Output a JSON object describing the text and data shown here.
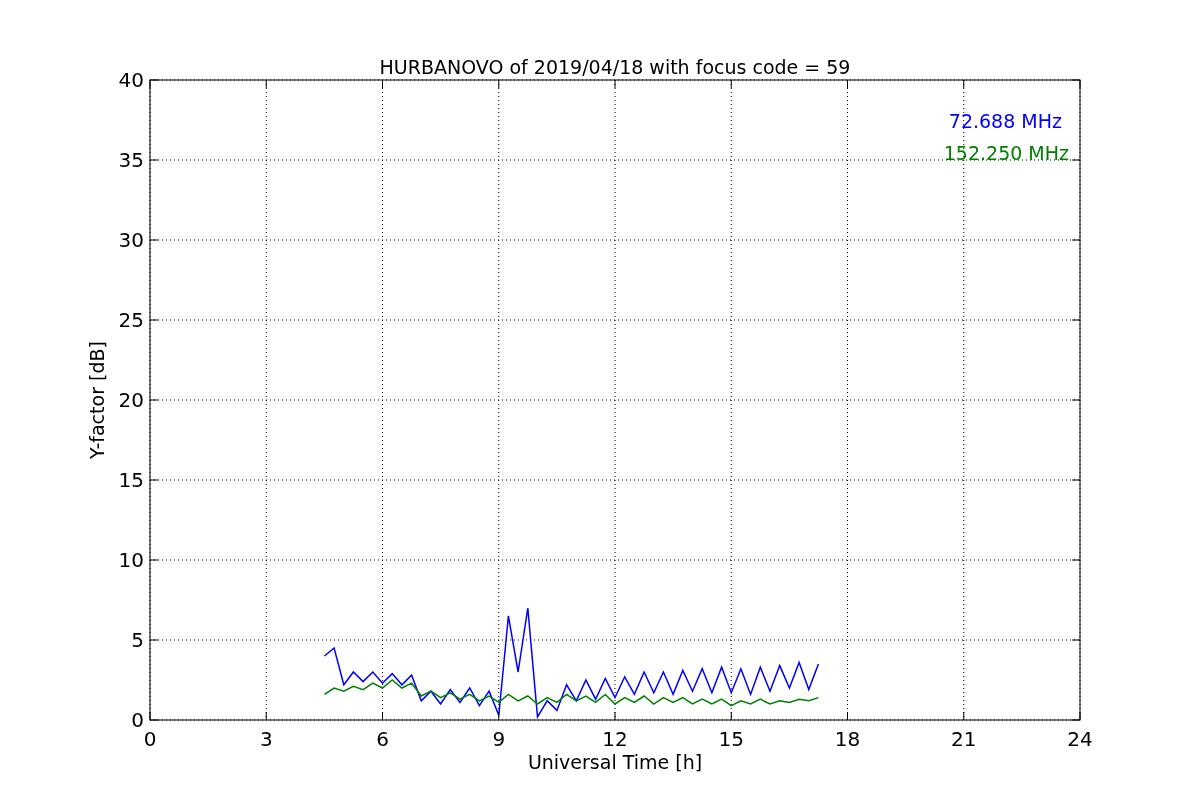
{
  "figure": {
    "chart_data": {
      "type": "line",
      "grid": true,
      "title": "HURBANOVO of 2019/04/18 with focus code = 59",
      "xlabel": "Universal Time [h]",
      "ylabel": "Y-factor [dB]",
      "xlim": [
        0,
        24
      ],
      "ylim": [
        0,
        40
      ],
      "xticks": [
        0,
        3,
        6,
        9,
        12,
        15,
        18,
        21,
        24
      ],
      "yticks": [
        0,
        5,
        10,
        15,
        20,
        25,
        30,
        35,
        40
      ],
      "x": [
        4.5,
        4.75,
        5.0,
        5.25,
        5.5,
        5.75,
        6.0,
        6.25,
        6.5,
        6.75,
        7.0,
        7.25,
        7.5,
        7.75,
        8.0,
        8.25,
        8.5,
        8.75,
        9.0,
        9.25,
        9.5,
        9.75,
        10.0,
        10.25,
        10.5,
        10.75,
        11.0,
        11.25,
        11.5,
        11.75,
        12.0,
        12.25,
        12.5,
        12.75,
        13.0,
        13.25,
        13.5,
        13.75,
        14.0,
        14.25,
        14.5,
        14.75,
        15.0,
        15.25,
        15.5,
        15.75,
        16.0,
        16.25,
        16.5,
        16.75,
        17.0,
        17.25
      ],
      "series": [
        {
          "name": "72.688 MHz",
          "color": "#0000ff",
          "values": [
            4.0,
            4.5,
            2.2,
            3.0,
            2.4,
            3.0,
            2.3,
            2.9,
            2.2,
            2.8,
            1.2,
            1.8,
            1.0,
            1.9,
            1.1,
            2.0,
            0.9,
            1.8,
            0.3,
            6.5,
            3.0,
            7.0,
            0.2,
            1.2,
            0.6,
            2.2,
            1.2,
            2.5,
            1.3,
            2.6,
            1.4,
            2.7,
            1.6,
            3.0,
            1.7,
            3.0,
            1.6,
            3.1,
            1.8,
            3.2,
            1.7,
            3.3,
            1.7,
            3.2,
            1.6,
            3.3,
            1.8,
            3.4,
            2.0,
            3.6,
            1.9,
            3.5
          ]
        },
        {
          "name": "152.250 MHz",
          "color": "#008000",
          "values": [
            1.6,
            2.0,
            1.8,
            2.1,
            1.9,
            2.3,
            2.0,
            2.5,
            2.0,
            2.3,
            1.5,
            1.8,
            1.4,
            1.7,
            1.3,
            1.6,
            1.2,
            1.5,
            1.1,
            1.6,
            1.2,
            1.5,
            1.0,
            1.4,
            1.1,
            1.6,
            1.2,
            1.5,
            1.1,
            1.6,
            1.0,
            1.4,
            1.1,
            1.5,
            1.0,
            1.4,
            1.1,
            1.4,
            1.0,
            1.3,
            1.0,
            1.3,
            0.9,
            1.2,
            1.0,
            1.3,
            1.0,
            1.2,
            1.1,
            1.3,
            1.2,
            1.4
          ]
        }
      ]
    }
  }
}
